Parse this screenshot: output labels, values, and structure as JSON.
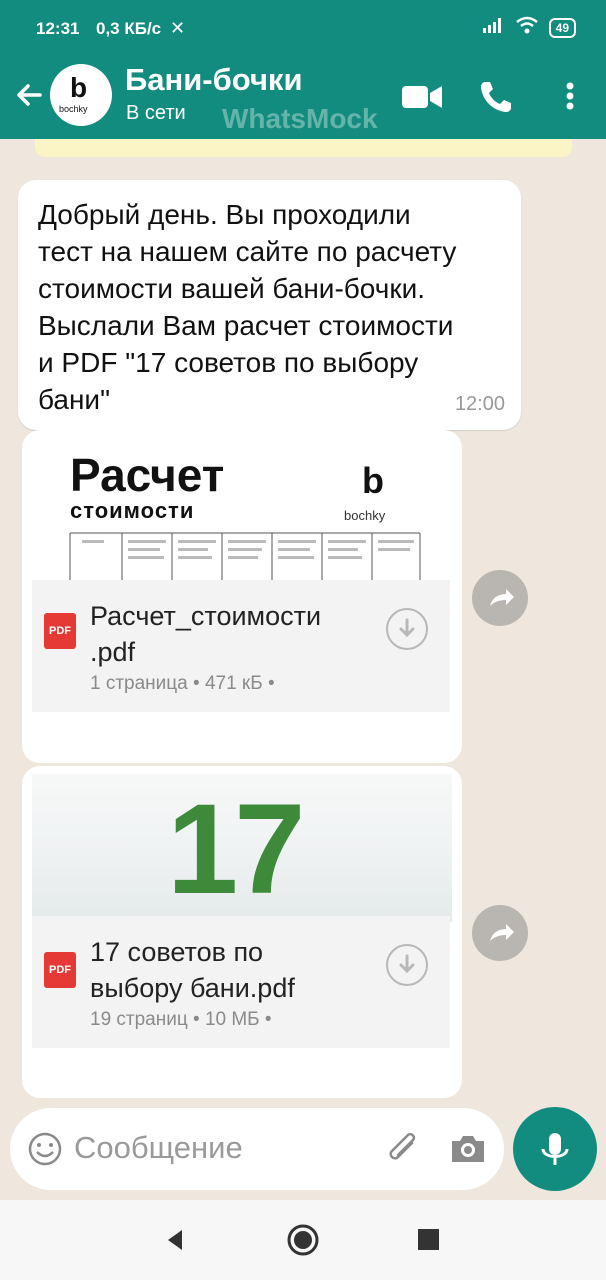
{
  "status_bar": {
    "time": "12:31",
    "network": "0,3 КБ/с",
    "battery": "49"
  },
  "header": {
    "title": "Бани-бочки",
    "subtitle": "В сети",
    "watermark": "WhatsMock",
    "avatar_brand": "bochky",
    "avatar_letter": "b"
  },
  "messages": [
    {
      "text": "Добрый день. Вы проходили\nтест на нашем сайте по расчету\nстоимости вашей бани-бочки.\nВыслали Вам расчет стоимости\nи PDF \"17 советов по выбору\nбани\"",
      "time": "12:00"
    }
  ],
  "documents": [
    {
      "preview_title": "Расчет",
      "preview_subtitle": "стоимости",
      "preview_brand": "bochky",
      "name": "Расчет_стоимости\n.pdf",
      "meta": "1 страница • 471 кБ •",
      "icon_label": "PDF"
    },
    {
      "preview_title": "17",
      "name": "17 советов по\nвыбору бани.pdf",
      "meta": "19 страниц • 10 МБ •",
      "icon_label": "PDF"
    }
  ],
  "composer": {
    "placeholder": "Сообщение"
  },
  "colors": {
    "primary": "#128c7e",
    "chat_bg": "#efe7de",
    "bubble": "#ffffff",
    "pdf_red": "#e53935",
    "green_17": "#3d8b3a"
  }
}
